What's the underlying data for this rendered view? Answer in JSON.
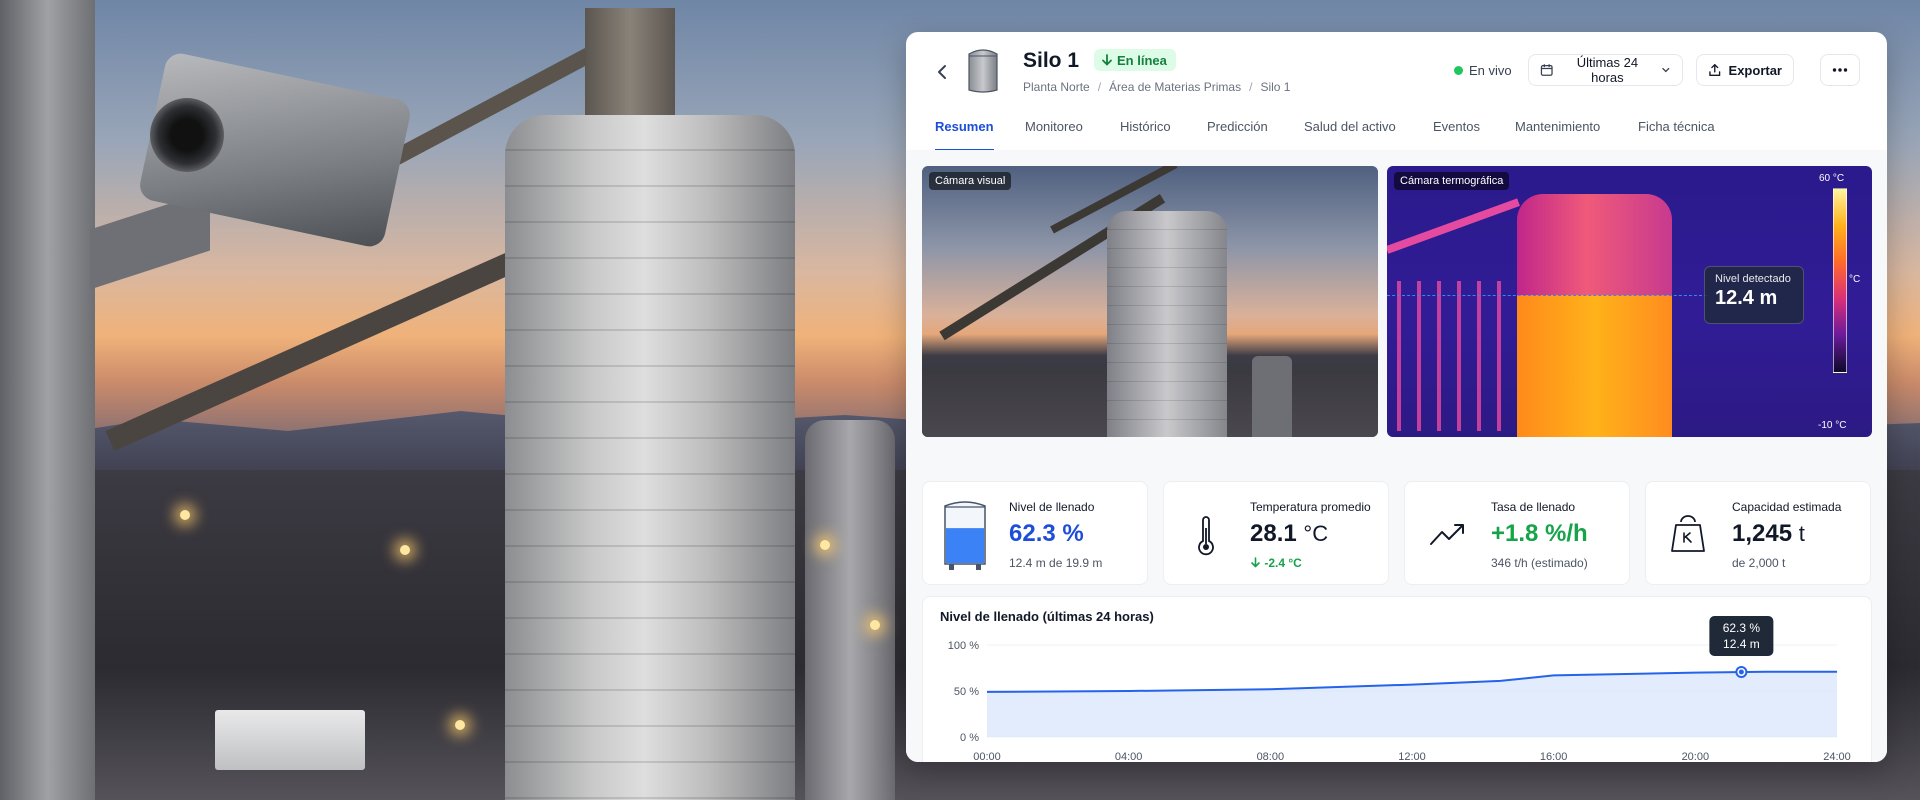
{
  "header": {
    "title": "Silo 1",
    "status_badge": "En línea",
    "breadcrumb": [
      "Planta Norte",
      "Área de Materias Primas",
      "Silo 1"
    ],
    "live_label": "En vivo",
    "range_label": "Últimas 24 horas",
    "export_label": "Exportar",
    "more_label": "···"
  },
  "tabs": [
    {
      "label": "Resumen",
      "active": true
    },
    {
      "label": "Monitoreo"
    },
    {
      "label": "Histórico"
    },
    {
      "label": "Predicción"
    },
    {
      "label": "Salud del activo"
    },
    {
      "label": "Eventos"
    },
    {
      "label": "Mantenimiento"
    },
    {
      "label": "Ficha técnica"
    }
  ],
  "cameras": {
    "visual_label": "Cámara visual",
    "thermal_label": "Cámara termográfica",
    "detected_label": "Nivel detectado",
    "detected_value": "12.4 m",
    "scale_max": "60 °C",
    "scale_unit": "°C",
    "scale_min": "-10 °C"
  },
  "kpis": [
    {
      "label": "Nivel de llenado",
      "value": "62.3 %",
      "unit": "",
      "sub": "12.4 m de 19.9 m",
      "icon": "silo-level-icon",
      "fill_fraction": 0.623
    },
    {
      "label": "Temperatura promedio",
      "value": "28.1",
      "unit": "°C",
      "sub": "-2.4 °C",
      "icon": "thermometer-icon"
    },
    {
      "label": "Tasa de llenado",
      "value": "+1.8 %/h",
      "unit": "",
      "sub": "346 t/h (estimado)",
      "icon": "trending-up-icon"
    },
    {
      "label": "Capacidad estimada",
      "value": "1,245",
      "unit": "t",
      "sub": "de 2,000 t",
      "icon": "weight-icon"
    }
  ],
  "chart_data": {
    "type": "area",
    "title": "Nivel de llenado (últimas 24 horas)",
    "x": [
      0,
      4,
      8,
      12,
      14.5,
      16,
      20,
      22,
      24
    ],
    "y": [
      49,
      50,
      52,
      57,
      61,
      67,
      70,
      71,
      71
    ],
    "x_ticks": [
      "00:00",
      "04:00",
      "08:00",
      "12:00",
      "16:00",
      "20:00",
      "24:00"
    ],
    "y_ticks": [
      "0 %",
      "50 %",
      "100 %"
    ],
    "xlim": [
      0,
      24
    ],
    "ylim": [
      0,
      100
    ],
    "grid": true,
    "tooltip": {
      "x": 21.3,
      "line1": "62.3 %",
      "line2": "12.4 m"
    },
    "colors": {
      "line": "#2563eb",
      "area": "#dbe7fb"
    }
  }
}
